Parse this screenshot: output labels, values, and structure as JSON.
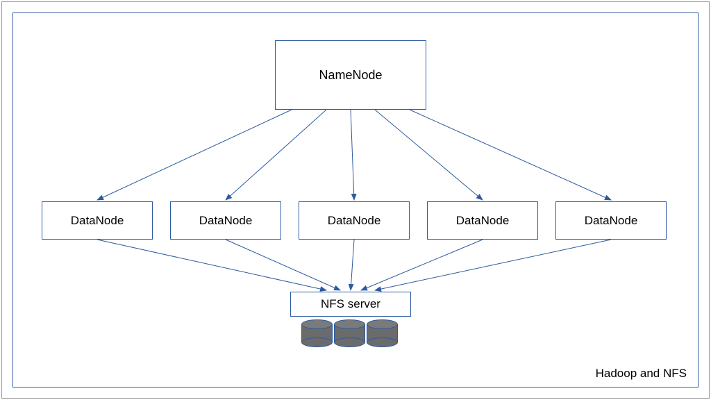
{
  "diagram": {
    "title": "Hadoop and NFS",
    "namenode": {
      "label": "NameNode"
    },
    "datanodes": [
      {
        "label": "DataNode"
      },
      {
        "label": "DataNode"
      },
      {
        "label": "DataNode"
      },
      {
        "label": "DataNode"
      },
      {
        "label": "DataNode"
      }
    ],
    "nfs": {
      "label": "NFS server"
    },
    "disk_count": 3
  }
}
